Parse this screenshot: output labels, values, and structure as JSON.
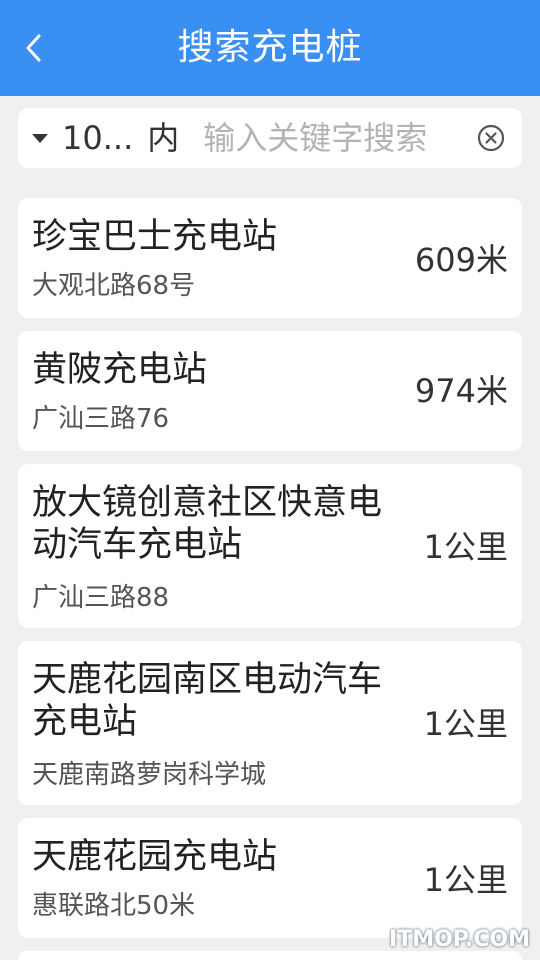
{
  "header": {
    "title": "搜索充电桩",
    "back_icon": "chevron-left-icon",
    "background_color": "#3a8ff2"
  },
  "search": {
    "range_value": "10...",
    "range_suffix": "内",
    "placeholder": "输入关键字搜索",
    "value": "",
    "dropdown_icon": "triangle-down-icon",
    "clear_icon": "circle-x-icon"
  },
  "stations": [
    {
      "name": "珍宝巴士充电站",
      "address": "大观北路68号",
      "distance": "609米"
    },
    {
      "name": "黄陂充电站",
      "address": "广汕三路76",
      "distance": "974米"
    },
    {
      "name": "放大镜创意社区快意电动汽车充电站",
      "address": "广汕三路88",
      "distance": "1公里"
    },
    {
      "name": "天鹿花园南区电动汽车充电站",
      "address": "天鹿南路萝岗科学城",
      "distance": "1公里"
    },
    {
      "name": "天鹿花园充电站",
      "address": "惠联路北50米",
      "distance": "1公里"
    }
  ],
  "watermark": "ITMOP.COM"
}
